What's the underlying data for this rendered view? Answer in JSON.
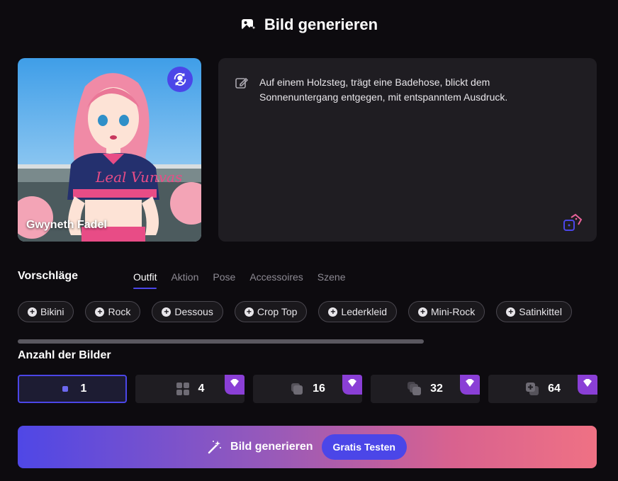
{
  "header": {
    "title": "Bild generieren",
    "icon": "image-sparkle-icon"
  },
  "character": {
    "name": "Gwyneth Fadel",
    "shirt_text": "Leal Vunvas"
  },
  "prompt": {
    "text": "Auf einem Holzsteg, trägt eine Badehose, blickt dem Sonnenuntergang entgegen, mit entspanntem Ausdruck."
  },
  "suggestions": {
    "title": "Vorschläge",
    "tabs": [
      {
        "label": "Outfit",
        "active": true
      },
      {
        "label": "Aktion"
      },
      {
        "label": "Pose"
      },
      {
        "label": "Accessoires"
      },
      {
        "label": "Szene"
      }
    ],
    "chips": [
      "Bikini",
      "Rock",
      "Dessous",
      "Crop Top",
      "Lederkleid",
      "Mini-Rock",
      "Satinkittel"
    ]
  },
  "image_count": {
    "title": "Anzahl der Bilder",
    "options": [
      {
        "value": "1",
        "selected": true,
        "premium": false
      },
      {
        "value": "4",
        "selected": false,
        "premium": true
      },
      {
        "value": "16",
        "selected": false,
        "premium": true
      },
      {
        "value": "32",
        "selected": false,
        "premium": true
      },
      {
        "value": "64",
        "selected": false,
        "premium": true
      }
    ]
  },
  "generate": {
    "label": "Bild generieren",
    "free_label": "Gratis Testen"
  },
  "colors": {
    "accent": "#4b46e8",
    "background": "#0d0b0f",
    "panel": "#1f1d22",
    "gradient_start": "#4f47e6",
    "gradient_end": "#ef7184"
  }
}
